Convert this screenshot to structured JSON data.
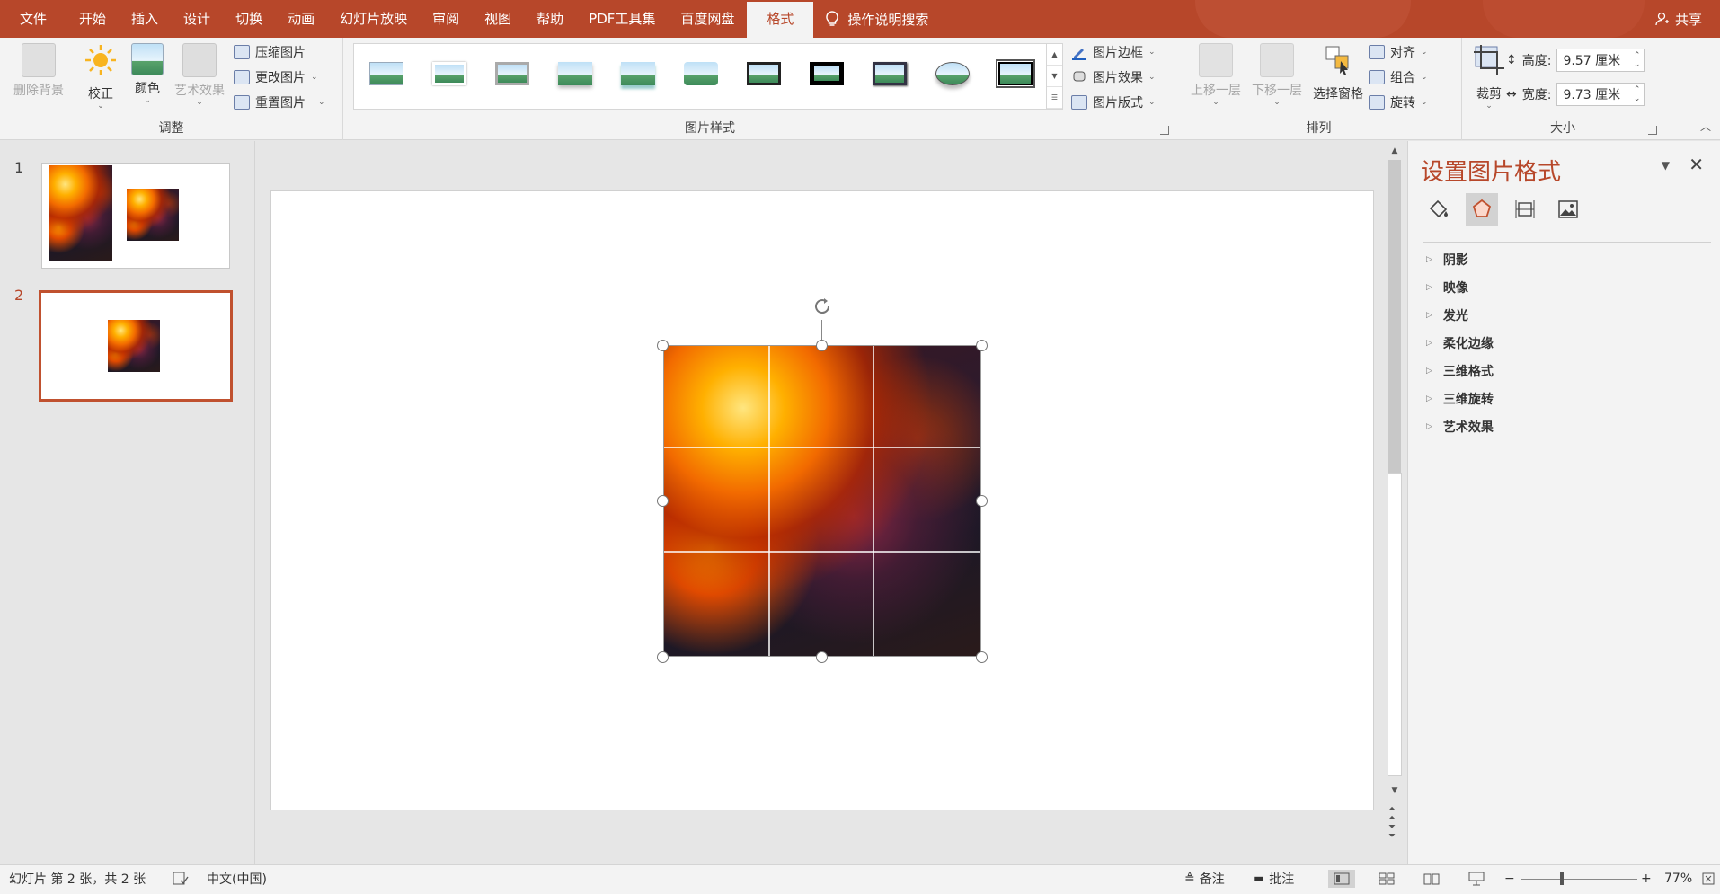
{
  "tabs": [
    "文件",
    "开始",
    "插入",
    "设计",
    "切换",
    "动画",
    "幻灯片放映",
    "审阅",
    "视图",
    "帮助",
    "PDF工具集",
    "百度网盘"
  ],
  "active_tab": "格式",
  "search_label": "操作说明搜索",
  "share_label": "共享",
  "ribbon": {
    "adjust": {
      "label": "调整",
      "remove_bg": "删除背景",
      "correct": "校正",
      "color": "颜色",
      "art_effect": "艺术效果",
      "compress": "压缩图片",
      "change": "更改图片",
      "reset": "重置图片"
    },
    "styles": {
      "label": "图片样式",
      "border": "图片边框",
      "effects": "图片效果",
      "layout": "图片版式"
    },
    "arrange": {
      "label": "排列",
      "bring_forward": "上移一层",
      "send_backward": "下移一层",
      "selection_pane": "选择窗格",
      "align": "对齐",
      "group": "组合",
      "rotate": "旋转"
    },
    "size": {
      "label": "大小",
      "crop": "裁剪",
      "height_label": "高度:",
      "height_value": "9.57 厘米",
      "width_label": "宽度:",
      "width_value": "9.73 厘米"
    }
  },
  "slides": [
    {
      "number": "1"
    },
    {
      "number": "2"
    }
  ],
  "format_pane": {
    "title": "设置图片格式",
    "sections": [
      "阴影",
      "映像",
      "发光",
      "柔化边缘",
      "三维格式",
      "三维旋转",
      "艺术效果"
    ]
  },
  "status": {
    "slide_info": "幻灯片 第 2 张，共 2 张",
    "language": "中文(中国)",
    "notes": "备注",
    "comments": "批注",
    "zoom_minus": "−",
    "zoom_plus": "+",
    "zoom": "77%"
  },
  "colors": {
    "accent": "#b7472a",
    "ribbon_bg": "#f3f3f3",
    "workspace_bg": "#e6e6e6"
  }
}
